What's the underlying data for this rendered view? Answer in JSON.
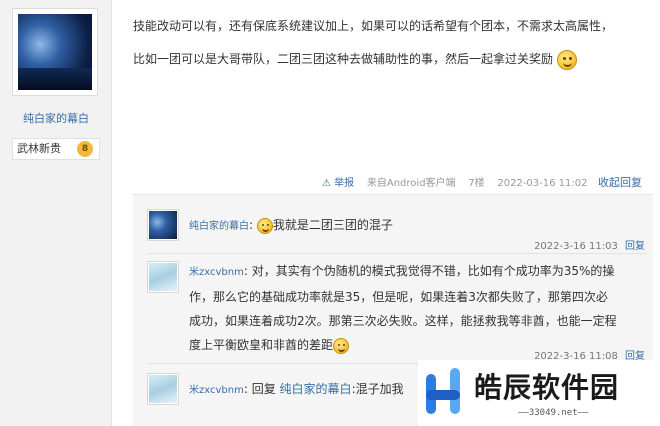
{
  "author": {
    "name": "纯白家的幕白",
    "rank": "武林新贵",
    "rank_level": "8"
  },
  "post": {
    "lines": [
      "技能改动可以有，还有保底系统建议加上，如果可以的话希望有个团本，不需求太高属性，",
      "比如一团可以是大哥带队，二团三团这种去做辅助性的事，然后一起拿过关奖励"
    ],
    "meta": {
      "report": "举报",
      "source": "来自Android客户端",
      "floor": "7楼",
      "time": "2022-03-16 11:02",
      "collapse": "收起回复"
    }
  },
  "replies": [
    {
      "user": "纯白家的幕白",
      "text": "我就是二团三团的混子",
      "time": "2022-3-16 11:03",
      "reply_btn": "回复"
    },
    {
      "user": "米zxcvbnm",
      "text_lines": [
        "对，其实有个伪随机的模式我觉得不错，比如有个成功率为35%的操",
        "作，那么它的基础成功率就是35，但是呢，如果连着3次都失败了，那第四次必",
        "成功，如果连着成功2次。那第三次必失败。这样，能拯救我等非酋，也能一定程",
        "度上平衡欧皇和非酋的差距"
      ],
      "time": "2022-3-16 11:08",
      "reply_btn": "回复"
    },
    {
      "user": "米zxcvbnm",
      "prefix": "回复",
      "target": "纯白家的幕白",
      "text": ":混子加我"
    }
  ],
  "watermark": {
    "title": "皓辰软件园",
    "url": "33049.net"
  },
  "colors": {
    "link": "#3a6ea5",
    "sidebar_bg": "#f2f2f2",
    "reply_bg": "#f5f5f5",
    "logo_blue": "#2d7be5"
  }
}
